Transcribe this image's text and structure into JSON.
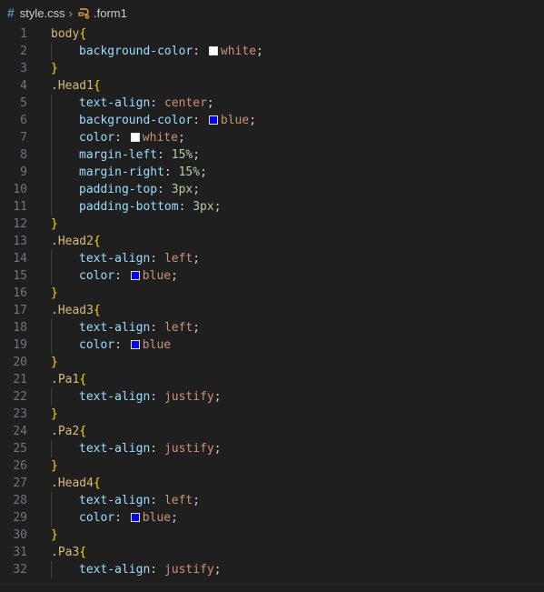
{
  "breadcrumb": {
    "file": "style.css",
    "symbol": ".form1",
    "file_icon": "hash-icon",
    "symbol_icon": "css-selector-icon"
  },
  "colors": {
    "background": "#1f1f1f",
    "line_number": "#6e7681",
    "selector": "#d7ba7d",
    "bracket": "#ffd700",
    "property": "#9cdcfe",
    "value": "#ce9178",
    "number": "#b5cea8",
    "swatch_white": "#ffffff",
    "swatch_blue": "#0000ff"
  },
  "lines": [
    {
      "n": "1",
      "sel": "body",
      "open": "{"
    },
    {
      "n": "2",
      "prop": "background-color",
      "swatch": "#ffffff",
      "val": "white",
      "end": ";"
    },
    {
      "n": "3",
      "close": "}"
    },
    {
      "n": "4",
      "sel": ".Head1",
      "open": "{"
    },
    {
      "n": "5",
      "prop": "text-align",
      "val": "center",
      "end": ";"
    },
    {
      "n": "6",
      "prop": "background-color",
      "swatch": "#0000ff",
      "val": "blue",
      "end": ";"
    },
    {
      "n": "7",
      "prop": "color",
      "swatch": "#ffffff",
      "val": "white",
      "end": ";"
    },
    {
      "n": "8",
      "prop": "margin-left",
      "num": "15%",
      "end": ";"
    },
    {
      "n": "9",
      "prop": "margin-right",
      "num": "15%",
      "end": ";"
    },
    {
      "n": "10",
      "prop": "padding-top",
      "num": "3px",
      "end": ";"
    },
    {
      "n": "11",
      "prop": "padding-bottom",
      "num": "3px",
      "end": ";"
    },
    {
      "n": "12",
      "close": "}"
    },
    {
      "n": "13",
      "sel": ".Head2",
      "open": "{"
    },
    {
      "n": "14",
      "prop": "text-align",
      "val": "left",
      "end": ";"
    },
    {
      "n": "15",
      "prop": "color",
      "swatch": "#0000ff",
      "val": "blue",
      "end": ";"
    },
    {
      "n": "16",
      "close": "}"
    },
    {
      "n": "17",
      "sel": ".Head3",
      "open": "{"
    },
    {
      "n": "18",
      "prop": "text-align",
      "val": "left",
      "end": ";"
    },
    {
      "n": "19",
      "prop": "color",
      "swatch": "#0000ff",
      "val": "blue",
      "end": ""
    },
    {
      "n": "20",
      "close": "}"
    },
    {
      "n": "21",
      "sel": ".Pa1",
      "open": "{"
    },
    {
      "n": "22",
      "prop": "text-align",
      "val": "justify",
      "end": ";"
    },
    {
      "n": "23",
      "close": "}"
    },
    {
      "n": "24",
      "sel": ".Pa2",
      "open": "{"
    },
    {
      "n": "25",
      "prop": "text-align",
      "val": "justify",
      "end": ";"
    },
    {
      "n": "26",
      "close": "}"
    },
    {
      "n": "27",
      "sel": ".Head4",
      "open": "{"
    },
    {
      "n": "28",
      "prop": "text-align",
      "val": "left",
      "end": ";"
    },
    {
      "n": "29",
      "prop": "color",
      "swatch": "#0000ff",
      "val": "blue",
      "end": ";"
    },
    {
      "n": "30",
      "close": "}"
    },
    {
      "n": "31",
      "sel": ".Pa3",
      "open": "{"
    },
    {
      "n": "32",
      "prop": "text-align",
      "val": "justify",
      "end": ";"
    }
  ]
}
